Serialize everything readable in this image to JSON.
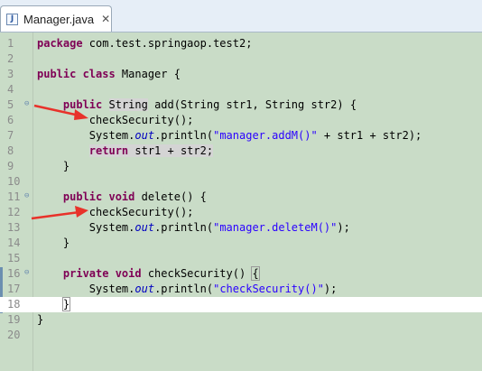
{
  "tab": {
    "title": "Manager.java",
    "close": "✕",
    "icon": "J"
  },
  "lines": [
    {
      "num": "1",
      "segs": [
        {
          "t": "package",
          "c": "kw"
        },
        {
          "t": " com.test.springaop.test2;"
        }
      ]
    },
    {
      "num": "2",
      "segs": []
    },
    {
      "num": "3",
      "segs": [
        {
          "t": "public class",
          "c": "kw"
        },
        {
          "t": " Manager {"
        }
      ]
    },
    {
      "num": "4",
      "segs": []
    },
    {
      "num": "5",
      "fold": true,
      "segs": [
        {
          "t": "    "
        },
        {
          "t": "public",
          "c": "kw"
        },
        {
          "t": " "
        },
        {
          "t": "String",
          "c": "occ"
        },
        {
          "t": " add(String str1, String str2) {"
        }
      ]
    },
    {
      "num": "6",
      "segs": [
        {
          "t": "        checkSecurity();"
        }
      ]
    },
    {
      "num": "7",
      "segs": [
        {
          "t": "        System."
        },
        {
          "t": "out",
          "c": "fld"
        },
        {
          "t": ".println("
        },
        {
          "t": "\"manager.addM()\"",
          "c": "str"
        },
        {
          "t": " + str1 + str2);"
        }
      ]
    },
    {
      "num": "8",
      "segs": [
        {
          "t": "        "
        },
        {
          "t": "return",
          "c": "kw occ"
        },
        {
          "t": " str1 + str2;",
          "c": "occ"
        }
      ]
    },
    {
      "num": "9",
      "segs": [
        {
          "t": "    }"
        }
      ]
    },
    {
      "num": "10",
      "segs": []
    },
    {
      "num": "11",
      "fold": true,
      "segs": [
        {
          "t": "    "
        },
        {
          "t": "public void",
          "c": "kw"
        },
        {
          "t": " delete() {"
        }
      ]
    },
    {
      "num": "12",
      "segs": [
        {
          "t": "        checkSecurity();"
        }
      ]
    },
    {
      "num": "13",
      "segs": [
        {
          "t": "        System."
        },
        {
          "t": "out",
          "c": "fld"
        },
        {
          "t": ".println("
        },
        {
          "t": "\"manager.deleteM()\"",
          "c": "str"
        },
        {
          "t": ");"
        }
      ]
    },
    {
      "num": "14",
      "segs": [
        {
          "t": "    }"
        }
      ]
    },
    {
      "num": "15",
      "segs": []
    },
    {
      "num": "16",
      "fold": true,
      "segs": [
        {
          "t": "    "
        },
        {
          "t": "private void",
          "c": "kw"
        },
        {
          "t": " checkSecurity() "
        },
        {
          "t": "{",
          "c": "brk"
        }
      ]
    },
    {
      "num": "17",
      "segs": [
        {
          "t": "        System."
        },
        {
          "t": "out",
          "c": "fld"
        },
        {
          "t": ".println("
        },
        {
          "t": "\"checkSecurity()\"",
          "c": "str"
        },
        {
          "t": ");"
        }
      ]
    },
    {
      "num": "18",
      "current": true,
      "segs": [
        {
          "t": "    "
        },
        {
          "t": "}",
          "c": "brk"
        }
      ]
    },
    {
      "num": "19",
      "segs": [
        {
          "t": "}"
        }
      ]
    },
    {
      "num": "20",
      "segs": []
    }
  ],
  "colors": {
    "background": "#c9dcc7",
    "keyword": "#7f0055",
    "string": "#2a00ff",
    "field": "#0000c0",
    "arrow": "#e8322a"
  }
}
